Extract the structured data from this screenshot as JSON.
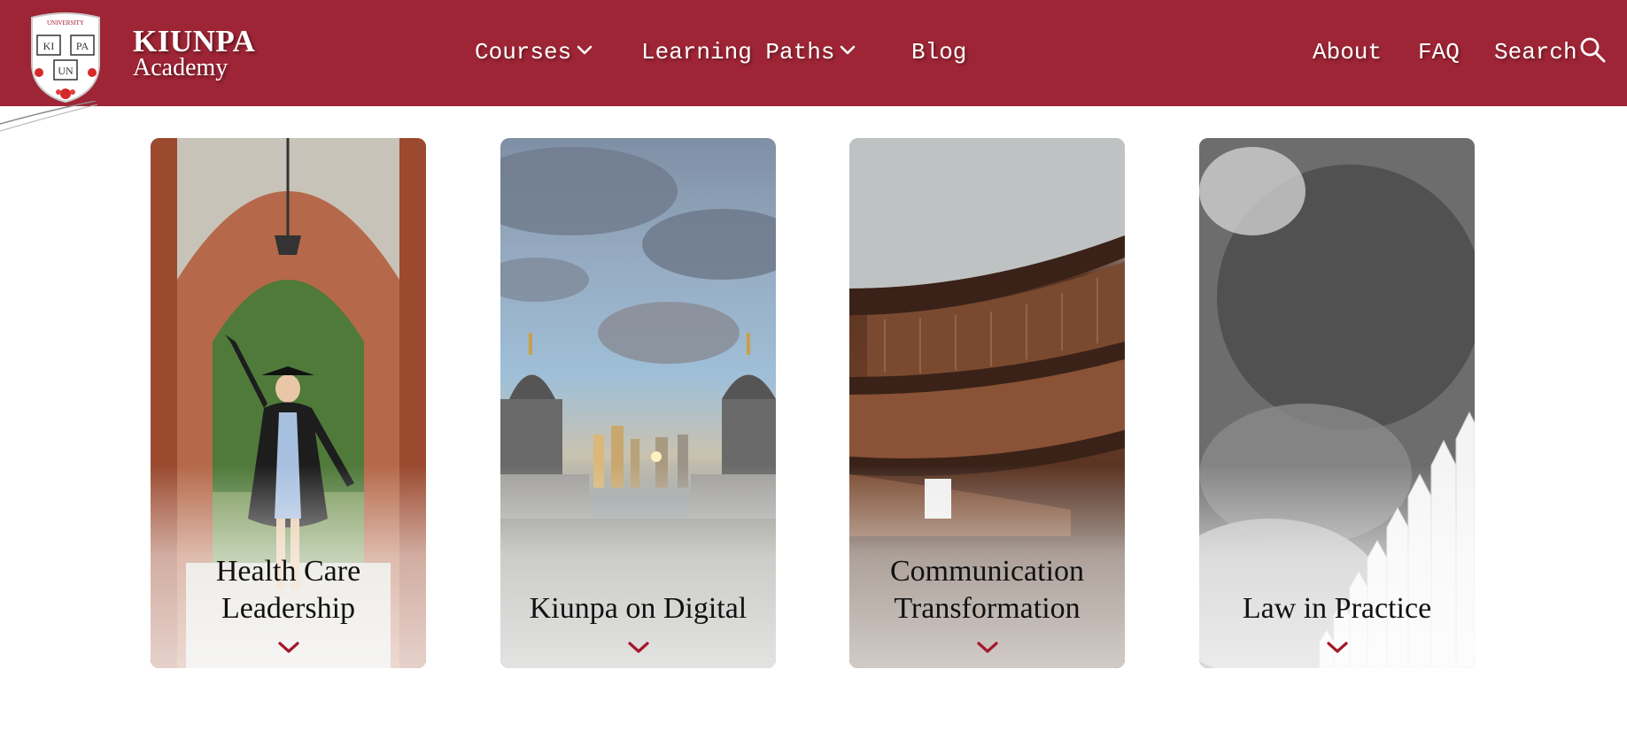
{
  "brand": {
    "name": "KIUNPA",
    "subtitle": "Academy",
    "logo_top_text": "UNIVERSITY",
    "logo_letters": [
      "KI",
      "PA",
      "UN"
    ]
  },
  "nav": {
    "courses": "Courses",
    "learning_paths": "Learning Paths",
    "blog": "Blog",
    "about": "About",
    "faq": "FAQ",
    "search": "Search"
  },
  "icons": {
    "courses_dropdown": "chevron-down-icon",
    "paths_dropdown": "chevron-down-icon",
    "search": "search-icon",
    "card_expand": "chevron-down-icon"
  },
  "colors": {
    "header_bg": "#9e2535",
    "accent": "#a3172c",
    "nav_text": "#ffffff"
  },
  "cards": [
    {
      "title": "Health Care Leadership"
    },
    {
      "title": "Kiunpa on Digital"
    },
    {
      "title": "Communication Transformation"
    },
    {
      "title": "Law in Practice"
    }
  ]
}
